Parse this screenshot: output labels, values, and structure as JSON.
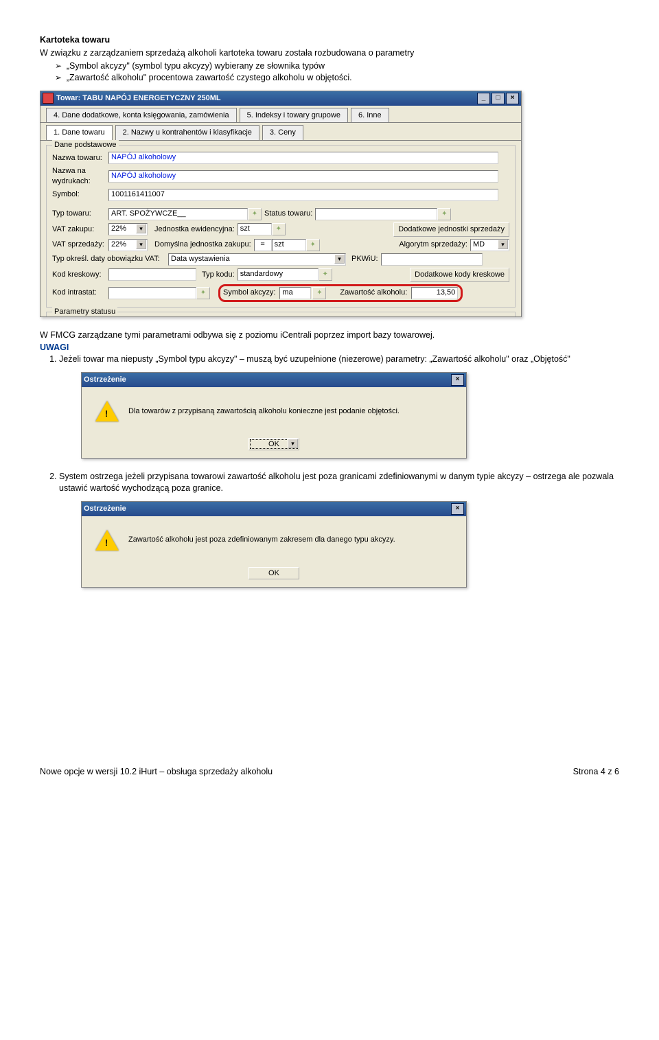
{
  "doc": {
    "h1": "Kartoteka towaru",
    "intro": "W związku z zarządzaniem sprzedażą alkoholi kartoteka towaru została rozbudowana o parametry",
    "bullet1_a": "„Symbol akcyzy\"",
    "bullet1_b": "(symbol typu akcyzy)",
    "bullet1_c": "wybierany ze słownika typów",
    "bullet2_a": "„Zawartość alkoholu\"",
    "bullet2_b": "procentowa zawartość czystego alkoholu w objętości.",
    "afterwin1": "W FMCG zarządzane tymi parametrami odbywa się z poziomu iCentrali poprzez import bazy towarowej.",
    "notes_h": "UWAGI",
    "note1": "Jeżeli towar ma niepusty „Symbol typu akcyzy\" – muszą być uzupełnione (niezerowe) parametry: „Zawartość alkoholu\" oraz „Objętość\"",
    "note2": "System ostrzega jeżeli przypisana towarowi zawartość alkoholu jest poza granicami zdefiniowanymi w danym typie akcyzy – ostrzega ale pozwala ustawić wartość wychodzącą poza granice.",
    "footer_l": "Nowe opcje w wersji 10.2 iHurt – obsługa sprzedaży alkoholu",
    "footer_r": "Strona 4 z 6"
  },
  "win1": {
    "title": "Towar: TABU NAPÓJ ENERGETYCZNY 250ML",
    "tab4": "4. Dane dodatkowe, konta księgowania, zamówienia",
    "tab5": "5. Indeksy i towary grupowe",
    "tab6": "6. Inne",
    "tab1": "1. Dane towaru",
    "tab2": "2. Nazwy u kontrahentów i klasyfikacje",
    "tab3": "3. Ceny",
    "grp_danepodst": "Dane podstawowe",
    "lbl_nazwa": "Nazwa towaru:",
    "val_nazwa": "NAPÓJ alkoholowy",
    "lbl_nazwawyd": "Nazwa na wydrukach:",
    "val_nazwawyd": "NAPÓJ alkoholowy",
    "lbl_symbol": "Symbol:",
    "val_symbol": "1001161411007",
    "lbl_typ": "Typ towaru:",
    "val_typ": "ART. SPOŻYWCZE__",
    "lbl_status": "Status towaru:",
    "lbl_vatz": "VAT zakupu:",
    "val_vatz": "22%",
    "lbl_jednew": "Jednostka ewidencyjna:",
    "val_jednew": "szt",
    "btn_dodjedn": "Dodatkowe jednostki sprzedaży",
    "lbl_vats": "VAT sprzedaży:",
    "val_vats": "22%",
    "lbl_domjedn": "Domyślna jednostka zakupu:",
    "val_eq": "=",
    "val_domjedn": "szt",
    "lbl_alg": "Algorytm sprzedaży:",
    "val_alg": "MD",
    "lbl_typokr": "Typ określ. daty obowiązku VAT:",
    "val_typokr": "Data wystawienia",
    "lbl_pkwiu": "PKWiU:",
    "lbl_kodk": "Kod kreskowy:",
    "lbl_typkodu": "Typ kodu:",
    "val_typkodu": "standardowy",
    "btn_dodkody": "Dodatkowe kody kreskowe",
    "lbl_intrastat": "Kod intrastat:",
    "lbl_symakc": "Symbol akcyzy:",
    "val_symakc": "ma",
    "lbl_zawalk": "Zawartość alkoholu:",
    "val_zawalk": "13,50",
    "grp_paramstat": "Parametry statusu"
  },
  "warn": {
    "title": "Ostrzeżenie",
    "ok": "OK",
    "msg1": "Dla towarów z przypisaną zawartością alkoholu konieczne jest podanie objętości.",
    "msg2": "Zawartość alkoholu jest poza zdefiniowanym zakresem dla danego typu akcyzy."
  }
}
